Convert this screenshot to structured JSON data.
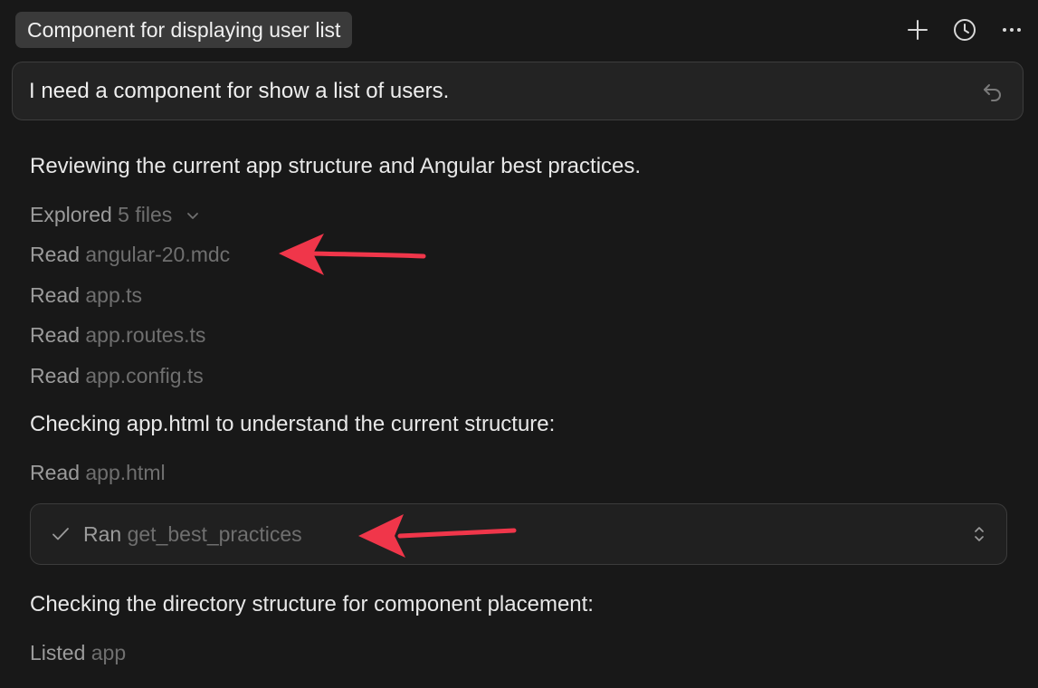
{
  "header": {
    "title": "Component for displaying user list",
    "actions": [
      {
        "name": "new-chat",
        "icon": "plus-icon"
      },
      {
        "name": "history",
        "icon": "clock-icon"
      },
      {
        "name": "more",
        "icon": "more-horizontal-icon"
      }
    ]
  },
  "prompt": {
    "text": "I need a component for show a list of users.",
    "icon": "undo-icon"
  },
  "messages": {
    "m1": "Reviewing the current app structure and Angular best practices.",
    "m2": "Checking app.html to understand the current structure:",
    "m3": "Checking the directory structure for component placement:"
  },
  "explored": {
    "verb": "Explored",
    "target": "5 files"
  },
  "reads": [
    {
      "verb": "Read",
      "target": "angular-20.mdc"
    },
    {
      "verb": "Read",
      "target": "app.ts"
    },
    {
      "verb": "Read",
      "target": "app.routes.ts"
    },
    {
      "verb": "Read",
      "target": "app.config.ts"
    }
  ],
  "read_html": {
    "verb": "Read",
    "target": "app.html"
  },
  "ran": {
    "verb": "Ran",
    "target": "get_best_practices"
  },
  "listed": {
    "verb": "Listed",
    "target": "app"
  },
  "colors": {
    "accent_arrow": "#f0364a",
    "background": "#181818"
  }
}
